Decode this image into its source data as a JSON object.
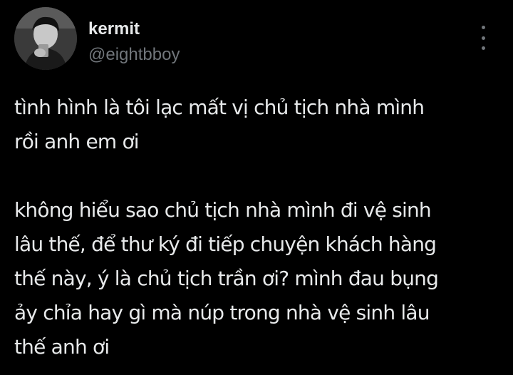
{
  "user": {
    "display_name": "kermit",
    "handle": "@eightbboy"
  },
  "icons": {
    "avatar": "profile-photo",
    "more": "vertical-ellipsis-icon"
  },
  "tweet": {
    "paragraph_1": [
      "tình hình là tôi lạc mất vị chủ tịch nhà mình",
      "rồi anh em ơi"
    ],
    "paragraph_2": [
      "không hiểu sao chủ tịch nhà mình đi vệ sinh",
      "lâu thế, để thư ký đi tiếp chuyện khách hàng",
      "thế này, ý là chủ tịch trần ơi? mình đau bụng",
      "ảy chỉa hay gì mà núp trong nhà vệ sinh lâu",
      "thế anh ơi"
    ]
  },
  "colors": {
    "background": "#000000",
    "primary_text": "#e7e9ea",
    "secondary_text": "#71767b"
  }
}
